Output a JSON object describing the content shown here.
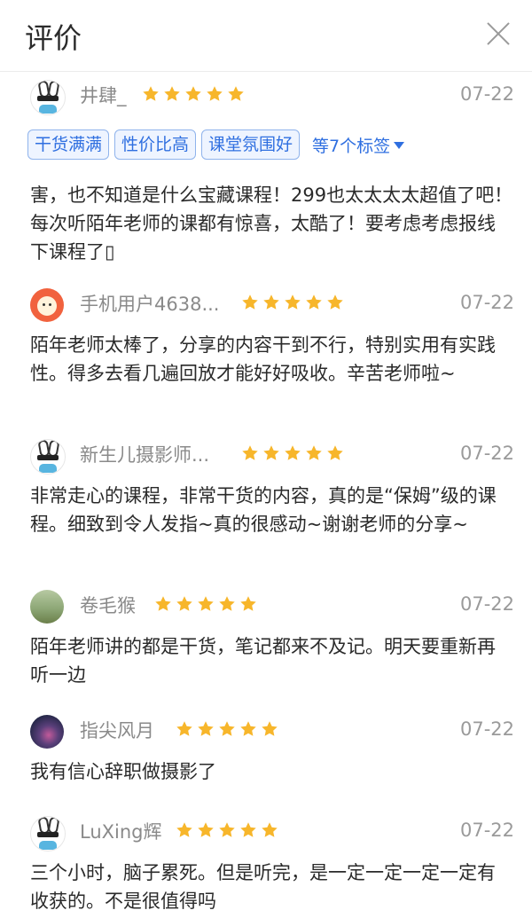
{
  "header": {
    "title": "评价",
    "close_icon": "close-icon"
  },
  "star_color": "#f7b62b",
  "tag_color": "#2f6fe0",
  "reviews": [
    {
      "user": "井肆_",
      "date": "07-22",
      "rating": 5,
      "tags": [
        "干货满满",
        "性价比高",
        "课堂氛围好"
      ],
      "more_tags": "等7个标签",
      "text": "害，也不知道是什么宝藏课程！299也太太太太超值了吧！每次听陌年老师的课都有惊喜，太酷了！要考虑考虑报线下课程了▯"
    },
    {
      "user": "手机用户4638...",
      "date": "07-22",
      "rating": 5,
      "text": "陌年老师太棒了，分享的内容干到不行，特别实用有实践性。得多去看几遍回放才能好好吸收。辛苦老师啦~"
    },
    {
      "user": "新生儿摄影师...",
      "date": "07-22",
      "rating": 5,
      "text": "非常走心的课程，非常干货的内容，真的是“保姆”级的课程。细致到令人发指~真的很感动~谢谢老师的分享~"
    },
    {
      "user": "卷毛猴",
      "date": "07-22",
      "rating": 5,
      "text": "陌年老师讲的都是干货，笔记都来不及记。明天要重新再听一边"
    },
    {
      "user": "指尖风月",
      "date": "07-22",
      "rating": 5,
      "text": "我有信心辞职做摄影了"
    },
    {
      "user": "LuXing辉",
      "date": "07-22",
      "rating": 5,
      "text": "三个小时，脑子累死。但是听完，是一定一定一定一定有收获的。不是很值得吗"
    }
  ]
}
